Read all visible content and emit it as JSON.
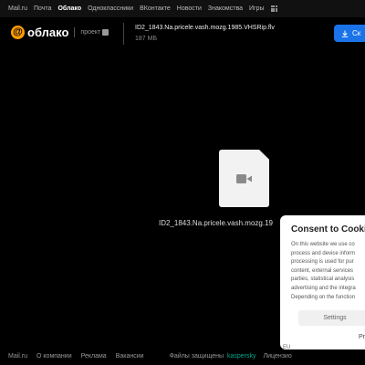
{
  "topnav": {
    "items": [
      "Mail.ru",
      "Почта",
      "Облако",
      "Одноклассники",
      "ВКонтакте",
      "Новости",
      "Знакомства",
      "Игры"
    ],
    "active": "Облако"
  },
  "header": {
    "logo_text": "облако",
    "project_label": "проект",
    "file_name": "ID2_1843.Na.pricele.vash.mozg.1985.VHSRip.flv",
    "file_size": "187 МБ",
    "download_label": "Ск"
  },
  "preview": {
    "file_label": "ID2_1843.Na.pricele.vash.mozg.19"
  },
  "footer": {
    "links": [
      "Mail.ru",
      "О компании",
      "Реклама",
      "Вакансии"
    ],
    "protected_label": "Файлы защищены",
    "kaspersky": "kaspersky",
    "license": "Лицензио"
  },
  "consent": {
    "title": "Consent to Cooki",
    "body": "On this website we use co\nprocess and device inform\nprocessing is used for pur\ncontent, external services\nparties, statistical analysis\nadvertising and the integra\nDepending on the function",
    "settings_label": "Settings",
    "primary_label": "Pr",
    "flag_label": "EU"
  },
  "colors": {
    "accent": "#1a73e8",
    "logo": "#ff9e00",
    "kaspersky": "#00a88e"
  }
}
